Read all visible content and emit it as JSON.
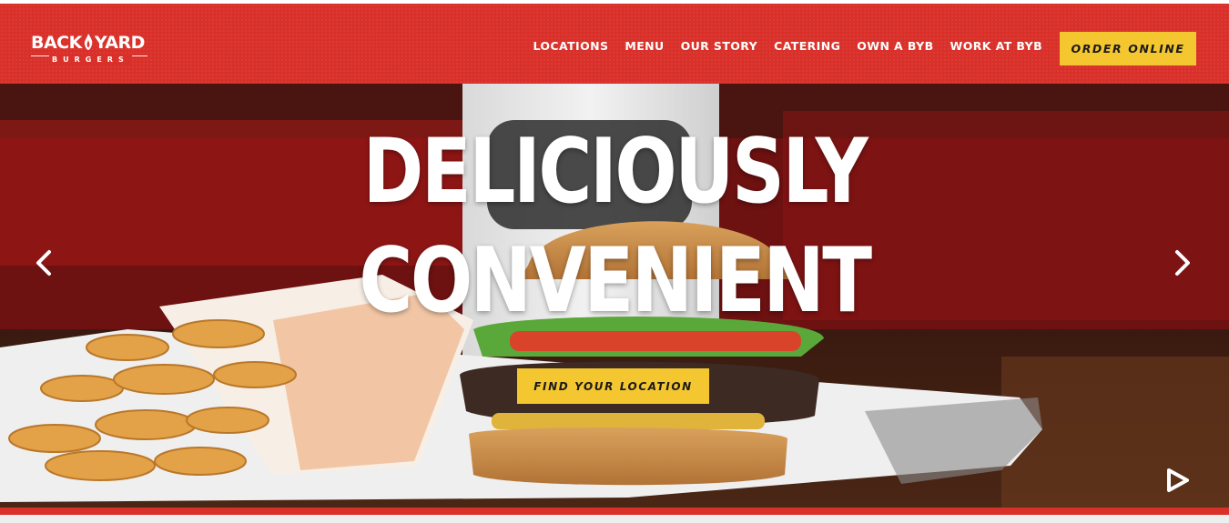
{
  "header": {
    "logo": {
      "word1": "BACK",
      "word2": "YARD",
      "tagline": "BURGERS"
    },
    "nav": [
      {
        "label": "LOCATIONS"
      },
      {
        "label": "MENU"
      },
      {
        "label": "OUR STORY"
      },
      {
        "label": "CATERING"
      },
      {
        "label": "OWN A BYB"
      },
      {
        "label": "WORK AT BYB"
      }
    ],
    "order_button": "ORDER ONLINE"
  },
  "hero": {
    "headline_line1": "DELICIOUSLY",
    "headline_line2": "CONVENIENT",
    "cta_button": "FIND YOUR LOCATION",
    "prev_icon": "chevron-left-icon",
    "next_icon": "chevron-right-icon",
    "play_icon": "play-icon"
  },
  "colors": {
    "brand_red": "#d9302a",
    "cta_yellow": "#f4c62f",
    "text_white": "#ffffff"
  }
}
